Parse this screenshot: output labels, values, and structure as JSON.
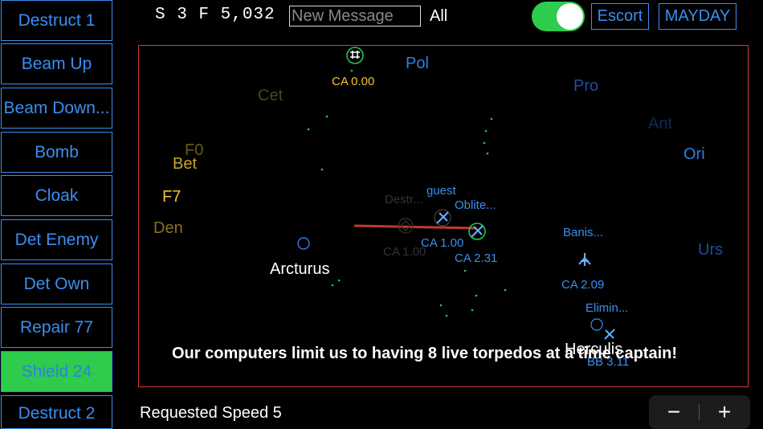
{
  "sidebar": {
    "buttons": [
      {
        "label": "Destruct 1"
      },
      {
        "label": "Beam Up"
      },
      {
        "label": "Beam Down..."
      },
      {
        "label": "Bomb"
      },
      {
        "label": "Cloak"
      },
      {
        "label": "Det Enemy"
      },
      {
        "label": "Det Own"
      },
      {
        "label": "Repair 77"
      },
      {
        "label": "Shield 24"
      },
      {
        "label": "Destruct 2"
      }
    ],
    "active_index": 8
  },
  "header": {
    "status": "S 3 F 5,032",
    "message_placeholder": "New Message",
    "recipient": "All",
    "toggle_on": true,
    "escort_label": "Escort",
    "mayday_label": "MAYDAY"
  },
  "map": {
    "stars": [
      {
        "name": "Pol",
        "color": "#2f7fe6"
      },
      {
        "name": "Cet",
        "color": "#4a4420"
      },
      {
        "name": "Pro",
        "color": "#1e4f9a"
      },
      {
        "name": "Ant",
        "color": "#0f2a55"
      },
      {
        "name": "Ori",
        "color": "#2f7fe6"
      },
      {
        "name": "F0",
        "color": "#6b5a10"
      },
      {
        "name": "Bet",
        "color": "#c9a227"
      },
      {
        "name": "F7",
        "color": "#f2c230"
      },
      {
        "name": "Den",
        "color": "#8a7020"
      },
      {
        "name": "Urs",
        "color": "#1e4f9a"
      },
      {
        "name": "Arcturus",
        "color": "#ffffff"
      },
      {
        "name": "Herculis",
        "color": "#ffffff"
      }
    ],
    "ships": [
      {
        "name": "",
        "class": "CA 0.00",
        "color": "#f2c230"
      },
      {
        "name": "Destr...",
        "class": "CA 1.00",
        "color": "#333333"
      },
      {
        "name": "guest",
        "class": "CA 1.00",
        "color": "#3a8ef0"
      },
      {
        "name": "Oblite...",
        "class": "CA 2.31",
        "color": "#3a8ef0"
      },
      {
        "name": "Banis...",
        "class": "CA 2.09",
        "color": "#3a8ef0"
      },
      {
        "name": "Elimin...",
        "class": "BB 3.11",
        "color": "#3a8ef0"
      }
    ],
    "message": "Our computers limit us to having 8 live torpedos at a time captain!"
  },
  "footer": {
    "speed_text": "Requested Speed 5",
    "minus": "−",
    "plus": "+"
  },
  "colors": {
    "accent": "#3a8ef0",
    "active": "#2ecb4c",
    "map_border": "#d23b3b",
    "phaser": "#c0392b",
    "torpedo": "#22cc55"
  }
}
